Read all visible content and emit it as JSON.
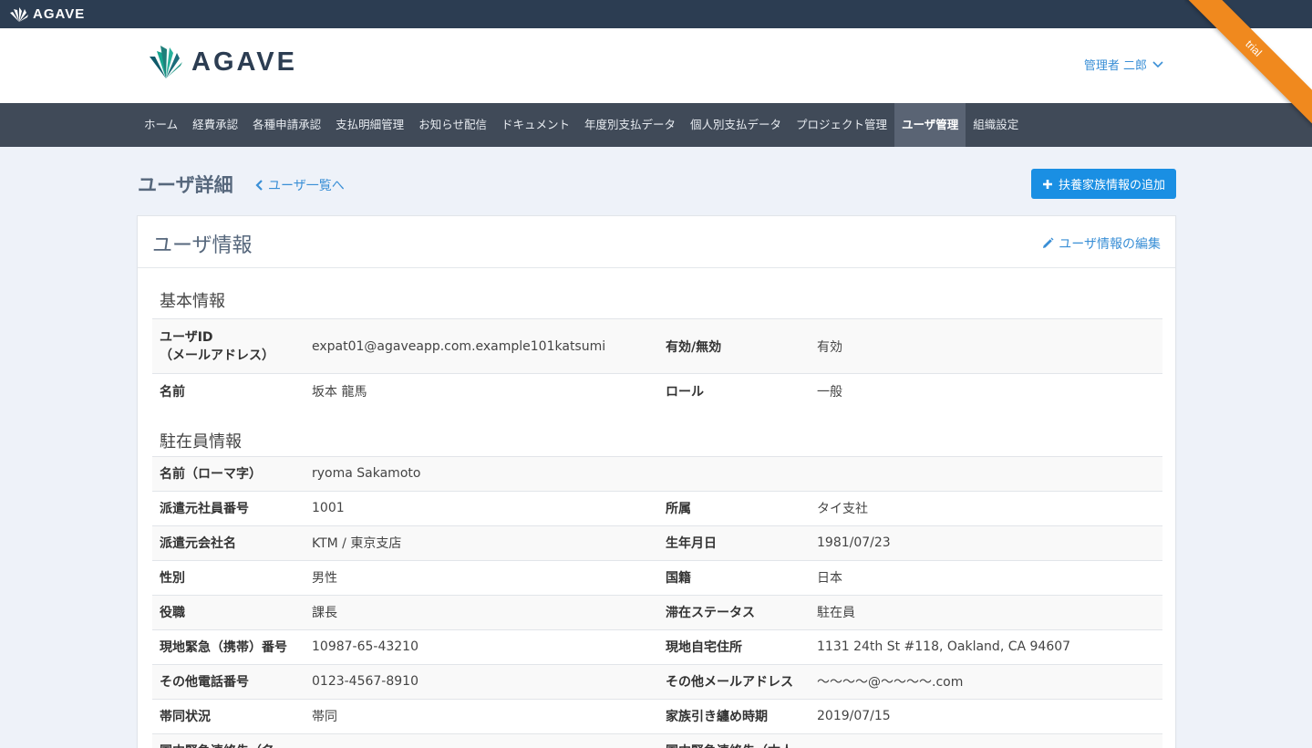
{
  "topbar": {
    "brand": "AGAVE"
  },
  "header": {
    "brand": "AGAVE",
    "user_name": "管理者 二郎",
    "ribbon": "trial"
  },
  "nav": {
    "items": [
      "ホーム",
      "経費承認",
      "各種申請承認",
      "支払明細管理",
      "お知らせ配信",
      "ドキュメント",
      "年度別支払データ",
      "個人別支払データ",
      "プロジェクト管理",
      "ユーザ管理",
      "組織設定"
    ],
    "active": "ユーザ管理"
  },
  "page": {
    "title": "ユーザ詳細",
    "back_link": "ユーザ一覧へ",
    "add_button": "扶養家族情報の追加"
  },
  "card": {
    "title": "ユーザ情報",
    "edit_link": "ユーザ情報の編集",
    "basic": {
      "title": "基本情報",
      "rows": [
        {
          "k1": "ユーザID\n（メールアドレス）",
          "v1": "expat01@agaveapp.com.example101katsumi",
          "k2": "有効/無効",
          "v2": "有効"
        },
        {
          "k1": "名前",
          "v1": "坂本 龍馬",
          "k2": "ロール",
          "v2": "一般"
        }
      ]
    },
    "expat": {
      "title": "駐在員情報",
      "rows": [
        {
          "k1": "名前（ローマ字）",
          "v1": "ryoma Sakamoto",
          "k2": "",
          "v2": ""
        },
        {
          "k1": "派遣元社員番号",
          "v1": "1001",
          "k2": "所属",
          "v2": "タイ支社"
        },
        {
          "k1": "派遣元会社名",
          "v1": "KTM / 東京支店",
          "k2": "生年月日",
          "v2": "1981/07/23"
        },
        {
          "k1": "性別",
          "v1": "男性",
          "k2": "国籍",
          "v2": "日本"
        },
        {
          "k1": "役職",
          "v1": "課長",
          "k2": "滞在ステータス",
          "v2": "駐在員"
        },
        {
          "k1": "現地緊急（携帯）番号",
          "v1": "10987-65-43210",
          "k2": "現地自宅住所",
          "v2": "1131 24th St #118, Oakland, CA 94607"
        },
        {
          "k1": "その他電話番号",
          "v1": "0123-4567-8910",
          "k2": "その他メールアドレス",
          "v2": "〜〜〜〜@〜〜〜〜.com"
        },
        {
          "k1": "帯同状況",
          "v1": "帯同",
          "k2": "家族引き纏め時期",
          "v2": "2019/07/15"
        },
        {
          "k1": "国内緊急連絡先（名",
          "v1": "",
          "k2": "国内緊急連絡先（本人",
          "v2": ""
        }
      ]
    }
  },
  "colors": {
    "topbar": "#2c3d52",
    "nav": "#404a58",
    "accent": "#1a8fe3",
    "link": "#3a8fd6",
    "ribbon": "#f0891e"
  }
}
